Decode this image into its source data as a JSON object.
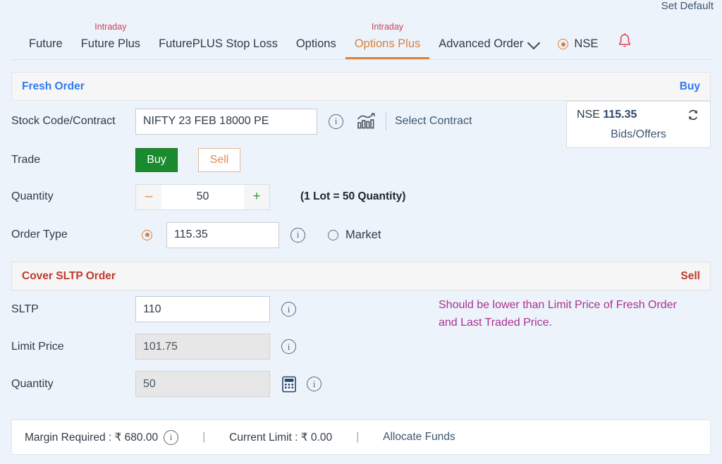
{
  "header": {
    "set_default": "Set Default",
    "tabs": [
      {
        "label": "Future",
        "badge": "",
        "active": false
      },
      {
        "label": "Future Plus",
        "badge": "Intraday",
        "active": false
      },
      {
        "label": "FuturePLUS Stop Loss",
        "badge": "",
        "active": false
      },
      {
        "label": "Options",
        "badge": "",
        "active": false
      },
      {
        "label": "Options Plus",
        "badge": "Intraday",
        "active": true
      }
    ],
    "advanced_order": "Advanced Order",
    "exchange": "NSE",
    "bell_icon": "bell-icon"
  },
  "fresh_order": {
    "title": "Fresh Order",
    "side": "Buy",
    "stock_label": "Stock Code/Contract",
    "stock_value": "NIFTY 23 FEB 18000 PE",
    "stock_placeholder": "Stock Code/Contract",
    "chart_icon": "bar-chart-icon",
    "select_contract": "Select Contract",
    "trade_label": "Trade",
    "buy_label": "Buy",
    "sell_label": "Sell",
    "quantity_label": "Quantity",
    "quantity_value": "50",
    "minus": "–",
    "plus": "+",
    "lot_note": "(1 Lot = 50 Quantity)",
    "order_type_label": "Order Type",
    "limit_price_value": "115.35",
    "limit_price_placeholder": "Price",
    "market_label": "Market"
  },
  "quote": {
    "exchange": "NSE",
    "price": "115.35",
    "bids_offers": "Bids/Offers",
    "refresh_icon": "refresh-icon"
  },
  "cover_order": {
    "title": "Cover SLTP Order",
    "side": "Sell",
    "sltp_label": "SLTP",
    "sltp_value": "110",
    "sltp_placeholder": "SLTP",
    "limit_label": "Limit Price",
    "limit_value": "101.75",
    "limit_placeholder": "Limit Price",
    "quantity_label": "Quantity",
    "quantity_value": "50",
    "quantity_placeholder": "Quantity",
    "calculator_icon": "calculator-icon",
    "hint": "Should be lower than Limit Price of Fresh Order and Last Traded Price."
  },
  "footer": {
    "margin_required": "Margin Required : ₹ 680.00",
    "current_limit": "Current Limit : ₹ 0.00",
    "allocate_funds": "Allocate Funds",
    "divider": "|"
  }
}
